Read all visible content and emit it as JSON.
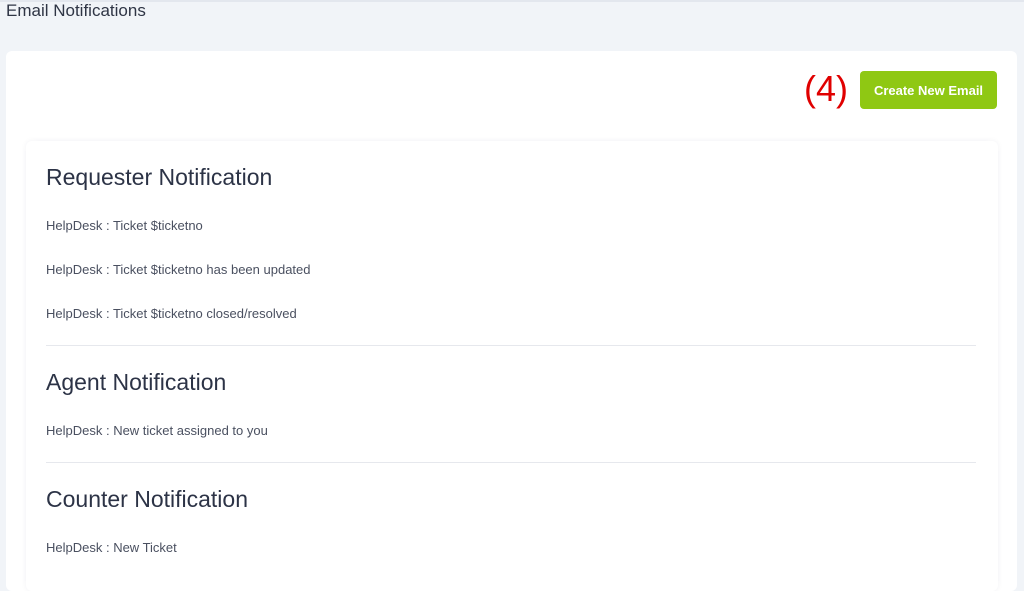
{
  "page": {
    "title": "Email Notifications"
  },
  "annotation": {
    "step": "(4)"
  },
  "toolbar": {
    "create_label": "Create New Email"
  },
  "sections": [
    {
      "title": "Requester Notification",
      "items": [
        "HelpDesk : Ticket $ticketno",
        "HelpDesk : Ticket $ticketno has been updated",
        "HelpDesk : Ticket $ticketno closed/resolved"
      ]
    },
    {
      "title": "Agent Notification",
      "items": [
        "HelpDesk : New ticket assigned to you"
      ]
    },
    {
      "title": "Counter Notification",
      "items": [
        "HelpDesk : New Ticket"
      ]
    }
  ],
  "colors": {
    "accent_button": "#8fc813",
    "step_marker": "#e00000",
    "page_background": "#f1f4f8"
  }
}
